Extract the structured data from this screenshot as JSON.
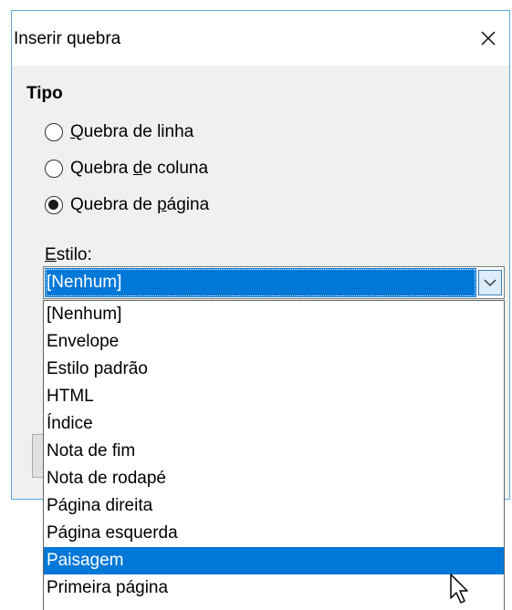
{
  "dialog": {
    "title": "Inserir quebra",
    "close_glyph": "✕",
    "type_section": {
      "title": "Tipo",
      "options": [
        {
          "pre": "",
          "accel": "Q",
          "post": "uebra de linha",
          "checked": false
        },
        {
          "pre": "Quebra ",
          "accel": "d",
          "post": "e coluna",
          "checked": false
        },
        {
          "pre": "Quebra de ",
          "accel": "p",
          "post": "ágina",
          "checked": true
        }
      ]
    },
    "style": {
      "label_accel": "E",
      "label_rest": "stilo:",
      "selected": "[Nenhum]",
      "arrow_icon": "chevron-down-icon"
    },
    "dropdown": {
      "items": [
        "[Nenhum]",
        "Envelope",
        "Estilo padrão",
        "HTML",
        "Índice",
        "Nota de fim",
        "Nota de rodapé",
        "Página direita",
        "Página esquerda",
        "Paisagem",
        "Primeira página"
      ],
      "highlighted": "Paisagem"
    }
  },
  "colors": {
    "accent": "#0078d7",
    "dialog_border": "#5fa8d9",
    "dialog_bg": "#f0f0f0"
  }
}
